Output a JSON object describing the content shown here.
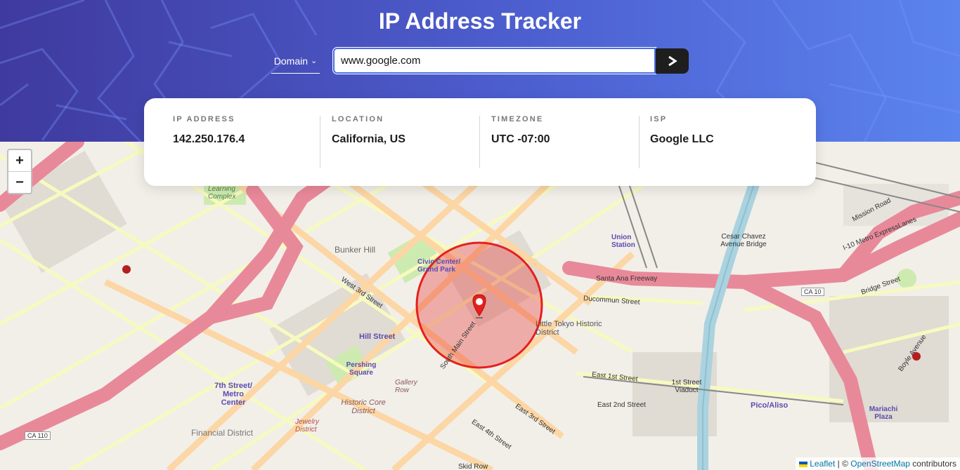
{
  "header": {
    "title": "IP Address Tracker",
    "search_type": "Domain",
    "search_value": "www.google.com",
    "submit_glyph": ">"
  },
  "info": {
    "ip": {
      "label": "IP ADDRESS",
      "value": "142.250.176.4"
    },
    "location": {
      "label": "LOCATION",
      "value": "California, US"
    },
    "timezone": {
      "label": "TIMEZONE",
      "value": "UTC -07:00"
    },
    "isp": {
      "label": "ISP",
      "value": "Google LLC"
    }
  },
  "map": {
    "zoom_in": "+",
    "zoom_out": "−",
    "attribution": {
      "leaflet": "Leaflet",
      "separator": " | © ",
      "osm": "OpenStreetMap",
      "suffix": " contributors"
    },
    "labels": {
      "bunker_hill": "Bunker Hill",
      "civic_center": "Civic Center/ Grand Park",
      "union_station": "Union Station",
      "cesar_chavez": "Cesar Chavez Avenue Bridge",
      "santa_ana": "Santa Ana Freeway",
      "little_tokyo": "Little Tokyo Historic District",
      "hill_street": "Hill Street",
      "pershing": "Pershing Square",
      "seventh_metro": "7th Street/ Metro Center",
      "historic_core": "Historic Core District",
      "financial": "Financial District",
      "jewelry": "Jewelry District",
      "gallery_row": "Gallery Row",
      "first_viaduct": "1st Street Viaduct",
      "pico_aliso": "Pico/Aliso",
      "mariachi": "Mariachi Plaza",
      "mission_road": "Mission Road",
      "i10": "I-10 Metro ExpressLanes",
      "learning": "Learning Complex",
      "west_3rd": "West 3rd Street",
      "south_main": "South Main Street",
      "east_1st": "East 1st Street",
      "east_2nd": "East 2nd Street",
      "east_3rd": "East 3rd Street",
      "east_4th": "East 4th Street",
      "ducommun": "Ducommun Street",
      "bridge": "Bridge Street",
      "boyle": "Boyle Avenue",
      "skid_row": "Skid Row",
      "ca110": "CA 110",
      "ca10": "CA 10"
    },
    "colors": {
      "land": "#f2efe9",
      "freeway": "#e8899a",
      "primary": "#fcd6a4",
      "secondary": "#f7fabf",
      "river": "#aad3df",
      "circle": "#e5201e"
    }
  }
}
